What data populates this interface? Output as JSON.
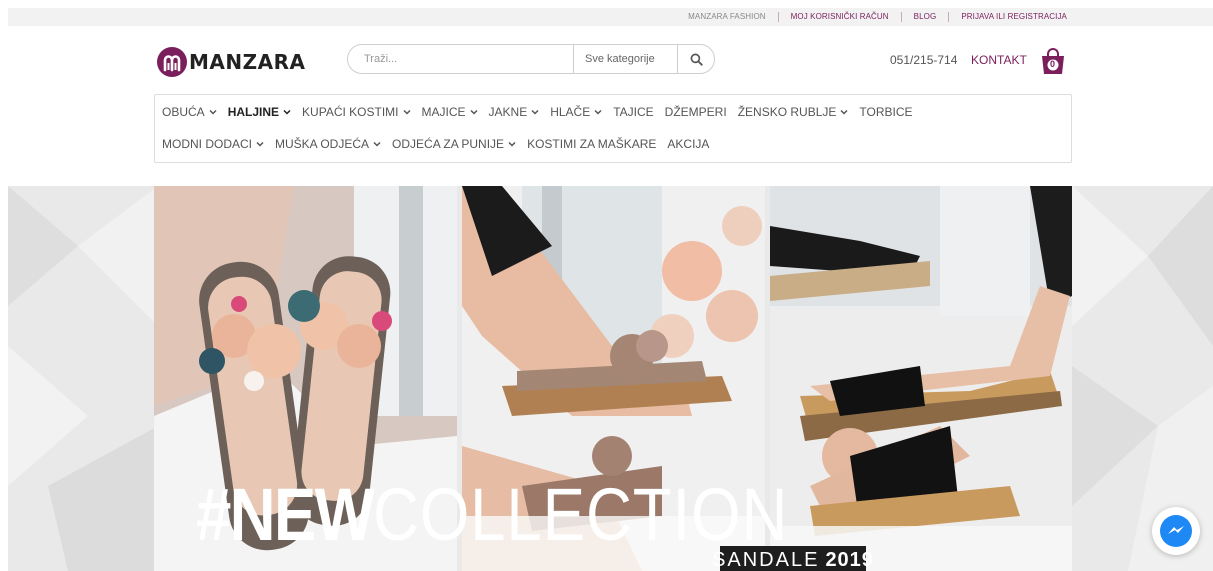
{
  "top_links": [
    "MANZARA FASHION",
    "MOJ KORISNIČKI RAČUN",
    "BLOG",
    "PRIJAVA ILI REGISTRACIJA"
  ],
  "logo": {
    "text": "MANZARA"
  },
  "search": {
    "placeholder": "Traži...",
    "category": "Sve kategorije"
  },
  "header": {
    "phone": "051/215-714",
    "contact": "KONTAKT",
    "cart_count": "0"
  },
  "nav": {
    "row1": [
      {
        "label": "OBUĆA",
        "dropdown": true,
        "bold": false
      },
      {
        "label": "HALJINE",
        "dropdown": true,
        "bold": true
      },
      {
        "label": "KUPAĆI KOSTIMI",
        "dropdown": true,
        "bold": false
      },
      {
        "label": "MAJICE",
        "dropdown": true,
        "bold": false
      },
      {
        "label": "JAKNE",
        "dropdown": true,
        "bold": false
      },
      {
        "label": "HLAČE",
        "dropdown": true,
        "bold": false
      },
      {
        "label": "TAJICE",
        "dropdown": false,
        "bold": false
      },
      {
        "label": "DŽEMPERI",
        "dropdown": false,
        "bold": false
      },
      {
        "label": "ŽENSKO RUBLJE",
        "dropdown": true,
        "bold": false
      },
      {
        "label": "TORBICE",
        "dropdown": false,
        "bold": false
      }
    ],
    "row2": [
      {
        "label": "MODNI DODACI",
        "dropdown": true,
        "bold": false
      },
      {
        "label": "MUŠKA ODJEĆA",
        "dropdown": true,
        "bold": false
      },
      {
        "label": "ODJEĆA ZA PUNIJE",
        "dropdown": true,
        "bold": false
      },
      {
        "label": "KOSTIMI ZA MAŠKARE",
        "dropdown": false,
        "bold": false
      },
      {
        "label": "AKCIJA",
        "dropdown": false,
        "bold": false
      }
    ]
  },
  "banner": {
    "headline_bold": "#NEW",
    "headline_light": "COLLECTION",
    "badge_light": "SANDALE",
    "badge_bold": "2019"
  },
  "colors": {
    "brand": "#7a1f5c",
    "messenger": "#1e88f5"
  }
}
